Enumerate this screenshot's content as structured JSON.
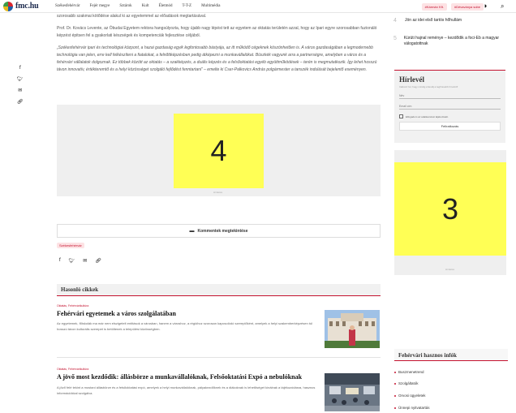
{
  "header": {
    "logo": "fmc.hu",
    "nav": [
      "Székesfehérvár",
      "Fejér megye",
      "Sztárok",
      "Kult",
      "Életmód",
      "T-T-Z",
      "Multimédia"
    ],
    "tags": [
      "#Kármán Kft.",
      "#Dévaványa sobe"
    ],
    "icons": [
      "contrast-toggle-icon",
      "search-icon"
    ]
  },
  "social_icons": [
    "facebook-icon",
    "twitter-icon",
    "email-icon",
    "link-icon"
  ],
  "article": {
    "paragraphs": [
      "szorosabb szakmai kötődése alakul ki az egyetemmel az előadások megtartásával.",
      "Prof. Dr. Kovács Levente, az Óbudai Egyetem rektora hangsúlyozta, hogy újabb nagy lépést tett az egyetem az oktatás területén azzal, hogy az Ipari egyre szorosabban fuzionáló képzést épitsen fel a gyakorlati készségek és kompetenciák fejlesztése céljából.",
      "„Székesfehérvár ipari és technológiai központ, a hazai gazdaság egyik legfontosabb bástyája, az itt működő cégeknek köszönhetően is. A város gazdaságában a legmodernebb technológia van jelen, erre kell felkészíteni a fiatalokat, a felnőttképzésben pedig átképezni a munkavállalókat. Büszkék vagyunk arra a partnerségre, amelyben a város és a fehérvári vállalatok dolgoznak. Ez többek között az oktatás – a szakképzés, a duális képzés és a felsőoktatási egyéb együttműködések – terén is megmutatkozik. Így lehet hosszú távon innovatív, értékteremtő és a helyi közösséget szolgáló fejlődést fenntartani” – emelte ki Cser-Palkovics András polgármester a tanszék indulását bejelentő eseményen."
    ],
    "ad_main": "4",
    "ad_main_label": "Hirdetés",
    "comment_button": "Kommentek megtekintése",
    "tag_chip": "Székesfehérvár",
    "share_icons": [
      "facebook-icon",
      "twitter-icon",
      "email-icon",
      "link-icon"
    ]
  },
  "similar": {
    "heading": "Hasonló cikkek",
    "cards": [
      {
        "tags": "Oktatás, Fehérvárikultúra",
        "title": "Fehérvári egyetemek a város szolgálatában",
        "text": "Az egyetemek, főiskolák ma már nem elszigetelt entitások a városban, hanem a városhoz, a régióhoz szorosan kapcsolódó szereplőként, amelyek a helyi szakemberképzésen túl hosszú távon kulturális szerepet is betöltenek a települési közösségben."
      },
      {
        "tags": "Oktatás, Fehérvárikultúra",
        "title": "A jövő most kezdődik: állásbörze a munkavállalóknak, Felsőoktatási Expó a nebulóknak",
        "text": "A jövő felé tekint a mostani állásbörze és a felsőoktatási expó, amelyek a helyi munkavállalóknak, pályakezdőknek és a diákoknak is lehetőséget kínálnak a tájékozódásra, hasznos információkkal szolgálva."
      }
    ]
  },
  "sidebar": {
    "ranked": [
      {
        "num": "4",
        "title": "Jön az idei első tartós hőhullám"
      },
      {
        "num": "5",
        "title": "Kürüti hajnal reménye – kezdődik a foci-Eb a magyar válogatottnak"
      }
    ],
    "newsletter": {
      "title": "Hírlevél",
      "subtitle": "Iratkozz fel, hogy mindig értesülj a legfrissebb hírekről!",
      "name_placeholder": "Név",
      "email_placeholder": "Email cím",
      "consent": "Elfogadom az adatkezelési tájékoztatót.",
      "button": "Feliratkozás"
    },
    "ad_side": "3",
    "ad_side_label": "Hirdetés",
    "info": {
      "title": "Fehérvári hasznos infók",
      "items": [
        "Buszmenetrend",
        "Szolgáltatók",
        "Orvosi ügyeletek",
        "Ünnepi nyitvatartás"
      ]
    }
  },
  "colors": {
    "accent": "#c4122f",
    "ad_fill": "#ffff55",
    "ad_frame": "#efefef"
  }
}
